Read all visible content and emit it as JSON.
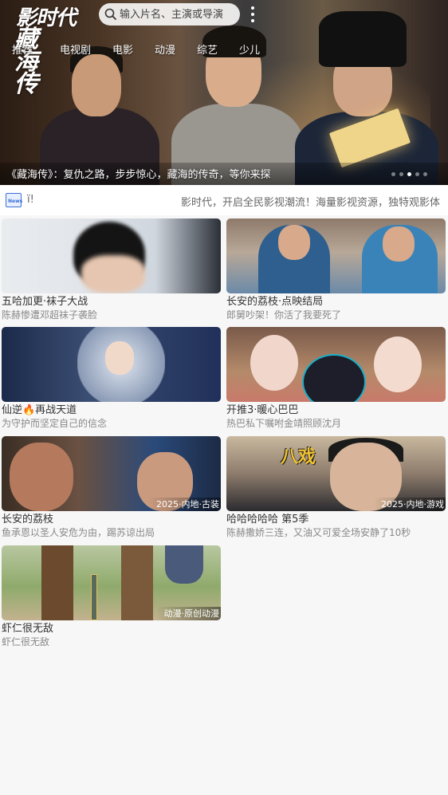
{
  "app": {
    "logo_text": "影时代",
    "banner_title_art": "藏海传"
  },
  "search": {
    "placeholder": "输入片名、主演或导演"
  },
  "nav_tabs": [
    "推荐",
    "电视剧",
    "电影",
    "动漫",
    "综艺",
    "少儿"
  ],
  "banner": {
    "caption": "《藏海传》：复仇之路，步步惊心，藏海的传奇，等你来探",
    "dot_count": 6,
    "active_dot": 3
  },
  "notice": {
    "icon": "news-icon",
    "icon_label": "News",
    "left_fragment": "ï!",
    "text": "影时代，开启全民影视潮流！海量影视资源，独特观影体"
  },
  "videos": [
    {
      "title": "五哈加更·袜子大战",
      "subtitle": "陈赫惨遭邓超袜子袭脸",
      "badge": ""
    },
    {
      "title": "长安的荔枝·点映结局",
      "subtitle": "郎舅吵架！你活了我要死了",
      "badge": ""
    },
    {
      "title": "仙逆🔥再战天道",
      "subtitle": "为守护而坚定自己的信念",
      "badge": ""
    },
    {
      "title": "开推3·暖心巴巴",
      "subtitle": "热巴私下嘱咐金靖照顾沈月",
      "badge": ""
    },
    {
      "title": "长安的荔枝",
      "subtitle": "鱼承恩以圣人安危为由，踢苏谅出局",
      "badge": "2025·内地·古装"
    },
    {
      "title": "哈哈哈哈哈 第5季",
      "subtitle": "陈赫撒娇三连，又油又可爱全场安静了10秒",
      "badge": "2025·内地·游戏"
    },
    {
      "title": "虾仁很无敌",
      "subtitle": "虾仁很无敌",
      "badge": "动漫·原创动漫"
    }
  ],
  "thumb_overlays": {
    "variety_logo": "八戏"
  }
}
